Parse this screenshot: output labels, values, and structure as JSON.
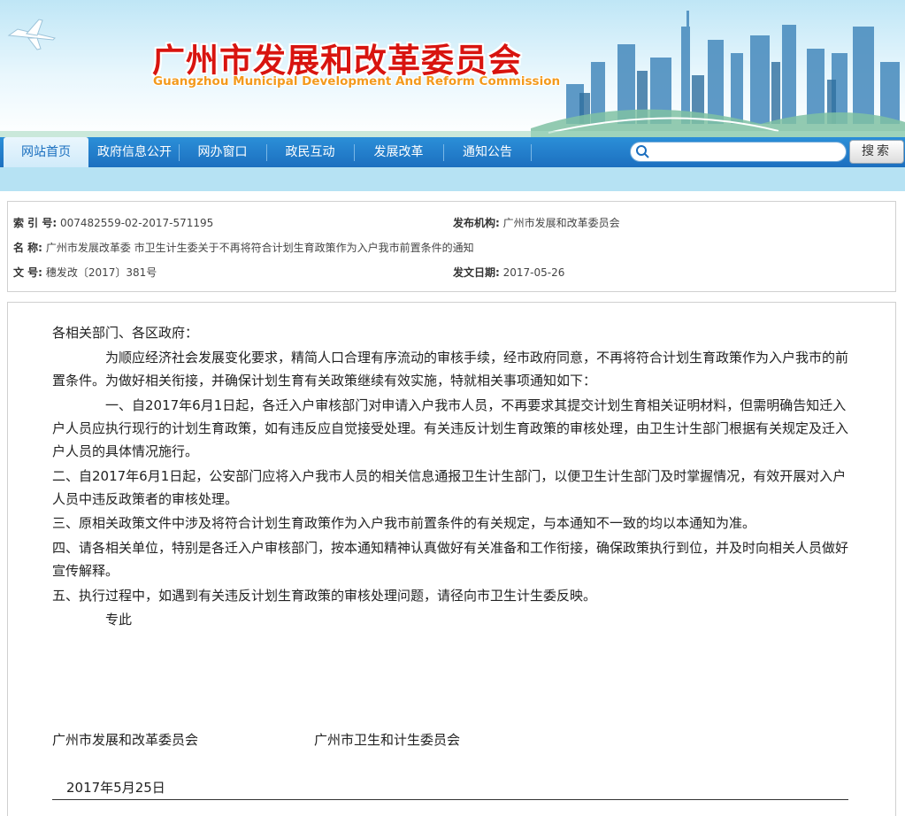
{
  "header": {
    "title": "广州市发展和改革委员会",
    "subtitle": "Guangzhou Municipal Development And Reform Commission"
  },
  "nav": {
    "items": [
      {
        "label": "网站首页",
        "active": true
      },
      {
        "label": "政府信息公开",
        "active": false
      },
      {
        "label": "网办窗口",
        "active": false
      },
      {
        "label": "政民互动",
        "active": false
      },
      {
        "label": "发展改革",
        "active": false
      },
      {
        "label": "通知公告",
        "active": false
      }
    ],
    "search_placeholder": "",
    "search_button": "搜索"
  },
  "meta": {
    "index_label": "索 引  号:",
    "index_value": "007482559-02-2017-571195",
    "publisher_label": "发布机构:",
    "publisher_value": "广州市发展和改革委员会",
    "name_label": "名      称:",
    "name_value": "广州市发展改革委 市卫生计生委关于不再将符合计划生育政策作为入户我市前置条件的通知",
    "doc_label": "文      号:",
    "doc_value": "穗发改〔2017〕381号",
    "date_label": "发文日期:",
    "date_value": "2017-05-26"
  },
  "body": {
    "salutation": "各相关部门、各区政府：",
    "p1": "为顺应经济社会发展变化要求，精简人口合理有序流动的审核手续，经市政府同意，不再将符合计划生育政策作为入户我市的前置条件。为做好相关衔接，并确保计划生育有关政策继续有效实施，特就相关事项通知如下：",
    "p2": "一、自2017年6月1日起，各迁入户审核部门对申请入户我市人员，不再要求其提交计划生育相关证明材料，但需明确告知迁入户人员应执行现行的计划生育政策，如有违反应自觉接受处理。有关违反计划生育政策的审核处理，由卫生计生部门根据有关规定及迁入户人员的具体情况施行。",
    "p3": "二、自2017年6月1日起，公安部门应将入户我市人员的相关信息通报卫生计生部门，以便卫生计生部门及时掌握情况，有效开展对入户人员中违反政策者的审核处理。",
    "p4": "三、原相关政策文件中涉及将符合计划生育政策作为入户我市前置条件的有关规定，与本通知不一致的均以本通知为准。",
    "p5": "四、请各相关单位，特别是各迁入户审核部门，按本通知精神认真做好有关准备和工作衔接，确保政策执行到位，并及时向相关人员做好宣传解释。",
    "p6": "五、执行过程中，如遇到有关违反计划生育政策的审核处理问题，请径向市卫生计生委反映。",
    "closing": "专此",
    "sign1": "广州市发展和改革委员会",
    "sign2": "广州市卫生和计生委员会",
    "date": "2017年5月25日"
  },
  "colors": {
    "title_red": "#d8140f",
    "subtitle_orange": "#f39a1d",
    "nav_blue": "#1c6fbf"
  }
}
